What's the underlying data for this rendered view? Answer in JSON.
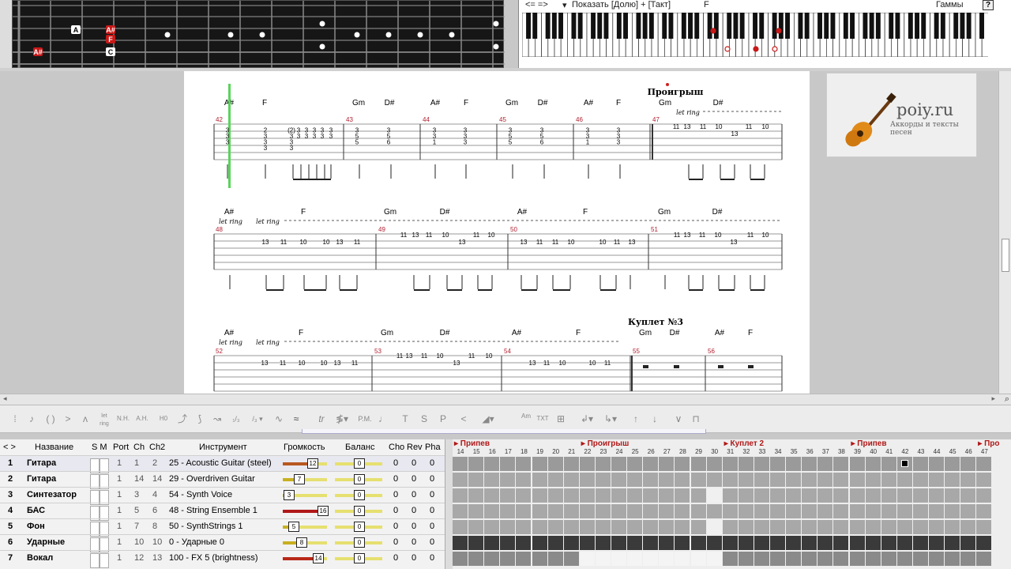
{
  "fretboard": {
    "labels": [
      {
        "text": "A",
        "string": 1,
        "fret": 4
      },
      {
        "text": "A#",
        "string": 1,
        "fret": 6
      },
      {
        "text": "F",
        "string": 2,
        "fret": 6
      },
      {
        "text": "A#",
        "string": 3,
        "fret": 1
      },
      {
        "text": "C",
        "string": 3,
        "fret": 6
      }
    ]
  },
  "piano_bar": {
    "nav": "<= =>",
    "show_label": "Показать [Долю] + [Такт]",
    "chord": "F",
    "scales_label": "Гаммы",
    "help": "?"
  },
  "logo": {
    "brand": "poiy.ru",
    "tagline": "Аккорды и тексты песен"
  },
  "score": {
    "section_proigrysh": "Проигрыш",
    "section_kuplet3": "Куплет №3",
    "let_ring": "let ring",
    "system1": {
      "chords": [
        [
          "A#",
          290
        ],
        [
          "F",
          335
        ],
        [
          "Gm",
          454
        ],
        [
          "D#",
          493
        ],
        [
          "A#",
          551
        ],
        [
          "F",
          590
        ],
        [
          "Gm",
          648
        ],
        [
          "D#",
          687
        ],
        [
          "A#",
          745
        ],
        [
          "F",
          783
        ],
        [
          "Gm",
          842
        ],
        [
          "D#",
          909
        ]
      ],
      "measures": [
        [
          "42",
          273
        ],
        [
          "43",
          438
        ],
        [
          "44",
          535
        ],
        [
          "45",
          632
        ],
        [
          "46",
          729
        ],
        [
          "47",
          826
        ]
      ]
    },
    "system2": {
      "chords": [
        [
          "A#",
          290
        ],
        [
          "F",
          384
        ],
        [
          "Gm",
          494
        ],
        [
          "D#",
          563
        ],
        [
          "A#",
          661
        ],
        [
          "F",
          741
        ],
        [
          "Gm",
          841
        ],
        [
          "D#",
          908
        ]
      ],
      "measures": [
        [
          "48",
          273
        ],
        [
          "49",
          479
        ],
        [
          "50",
          646
        ],
        [
          "51",
          824
        ]
      ]
    },
    "system3": {
      "chords": [
        [
          "A#",
          290
        ],
        [
          "F",
          381
        ],
        [
          "Gm",
          490
        ],
        [
          "D#",
          563
        ],
        [
          "A#",
          654
        ],
        [
          "F",
          732
        ],
        [
          "Gm",
          817
        ],
        [
          "D#",
          854
        ],
        [
          "A#",
          911
        ],
        [
          "F",
          950
        ]
      ],
      "measures": [
        [
          "52",
          273
        ],
        [
          "53",
          474
        ],
        [
          "54",
          638
        ],
        [
          "55",
          801
        ],
        [
          "56",
          896
        ]
      ]
    }
  },
  "tracks": {
    "headers": {
      "name": "Название",
      "sm": "S M",
      "port": "Port",
      "ch": "Ch",
      "ch2": "Ch2",
      "instrument": "Инструмент",
      "volume": "Громкость",
      "balance": "Баланс",
      "cho": "Cho",
      "rev": "Rev",
      "pha": "Pha"
    },
    "rows": [
      {
        "num": "1",
        "name": "Гитара",
        "port": "1",
        "ch": "1",
        "ch2": "2",
        "instrument": "25 - Acoustic Guitar (steel)",
        "volume": "12",
        "vol_frac": 0.75,
        "vol_color": "#b85820",
        "balance": "0",
        "cho": "0",
        "rev": "0",
        "pha": "0"
      },
      {
        "num": "2",
        "name": "Гитара",
        "port": "1",
        "ch": "14",
        "ch2": "14",
        "instrument": "29 - Overdriven Guitar",
        "volume": "7",
        "vol_frac": 0.44,
        "vol_color": "#c8b020",
        "balance": "0",
        "cho": "0",
        "rev": "0",
        "pha": "0"
      },
      {
        "num": "3",
        "name": "Синтезатор",
        "port": "1",
        "ch": "3",
        "ch2": "4",
        "instrument": "54 - Synth Voice",
        "volume": "3",
        "vol_frac": 0.2,
        "vol_color": "#c8b020",
        "balance": "0",
        "cho": "0",
        "rev": "0",
        "pha": "0"
      },
      {
        "num": "4",
        "name": "БАС",
        "port": "1",
        "ch": "5",
        "ch2": "6",
        "instrument": "48 - String Ensemble 1",
        "volume": "16",
        "vol_frac": 1.0,
        "vol_color": "#b01818",
        "balance": "0",
        "cho": "0",
        "rev": "0",
        "pha": "0"
      },
      {
        "num": "5",
        "name": "Фон",
        "port": "1",
        "ch": "7",
        "ch2": "8",
        "instrument": "50 - SynthStrings 1",
        "volume": "5",
        "vol_frac": 0.31,
        "vol_color": "#c8b020",
        "balance": "0",
        "cho": "0",
        "rev": "0",
        "pha": "0"
      },
      {
        "num": "6",
        "name": "Ударные",
        "port": "1",
        "ch": "10",
        "ch2": "10",
        "instrument": "0 - Ударные 0",
        "volume": "8",
        "vol_frac": 0.5,
        "vol_color": "#c8b020",
        "balance": "0",
        "cho": "0",
        "rev": "0",
        "pha": "0"
      },
      {
        "num": "7",
        "name": "Вокал",
        "port": "1",
        "ch": "12",
        "ch2": "13",
        "instrument": "100 - FX 5 (brightness)",
        "volume": "14",
        "vol_frac": 0.88,
        "vol_color": "#b82818",
        "balance": "0",
        "cho": "0",
        "rev": "0",
        "pha": "0"
      }
    ]
  },
  "timeline": {
    "sections": [
      [
        "Припев",
        0
      ],
      [
        "Проигрыш",
        8
      ],
      [
        "Куплет 2",
        17
      ],
      [
        "Припев",
        25
      ],
      [
        "Про",
        33
      ]
    ],
    "numbers": [
      "14",
      "15",
      "16",
      "17",
      "18",
      "19",
      "20",
      "21",
      "22",
      "23",
      "24",
      "25",
      "26",
      "27",
      "28",
      "29",
      "30",
      "31",
      "32",
      "33",
      "34",
      "35",
      "36",
      "37",
      "38",
      "39",
      "40",
      "41",
      "42",
      "43",
      "44",
      "45",
      "46",
      "47"
    ]
  },
  "toolbar": {
    "labels": [
      "H0",
      "L",
      "N.H.",
      "A.H.",
      "tr",
      "P.M.",
      "T",
      "S",
      "P",
      "Am",
      "TXT"
    ]
  }
}
